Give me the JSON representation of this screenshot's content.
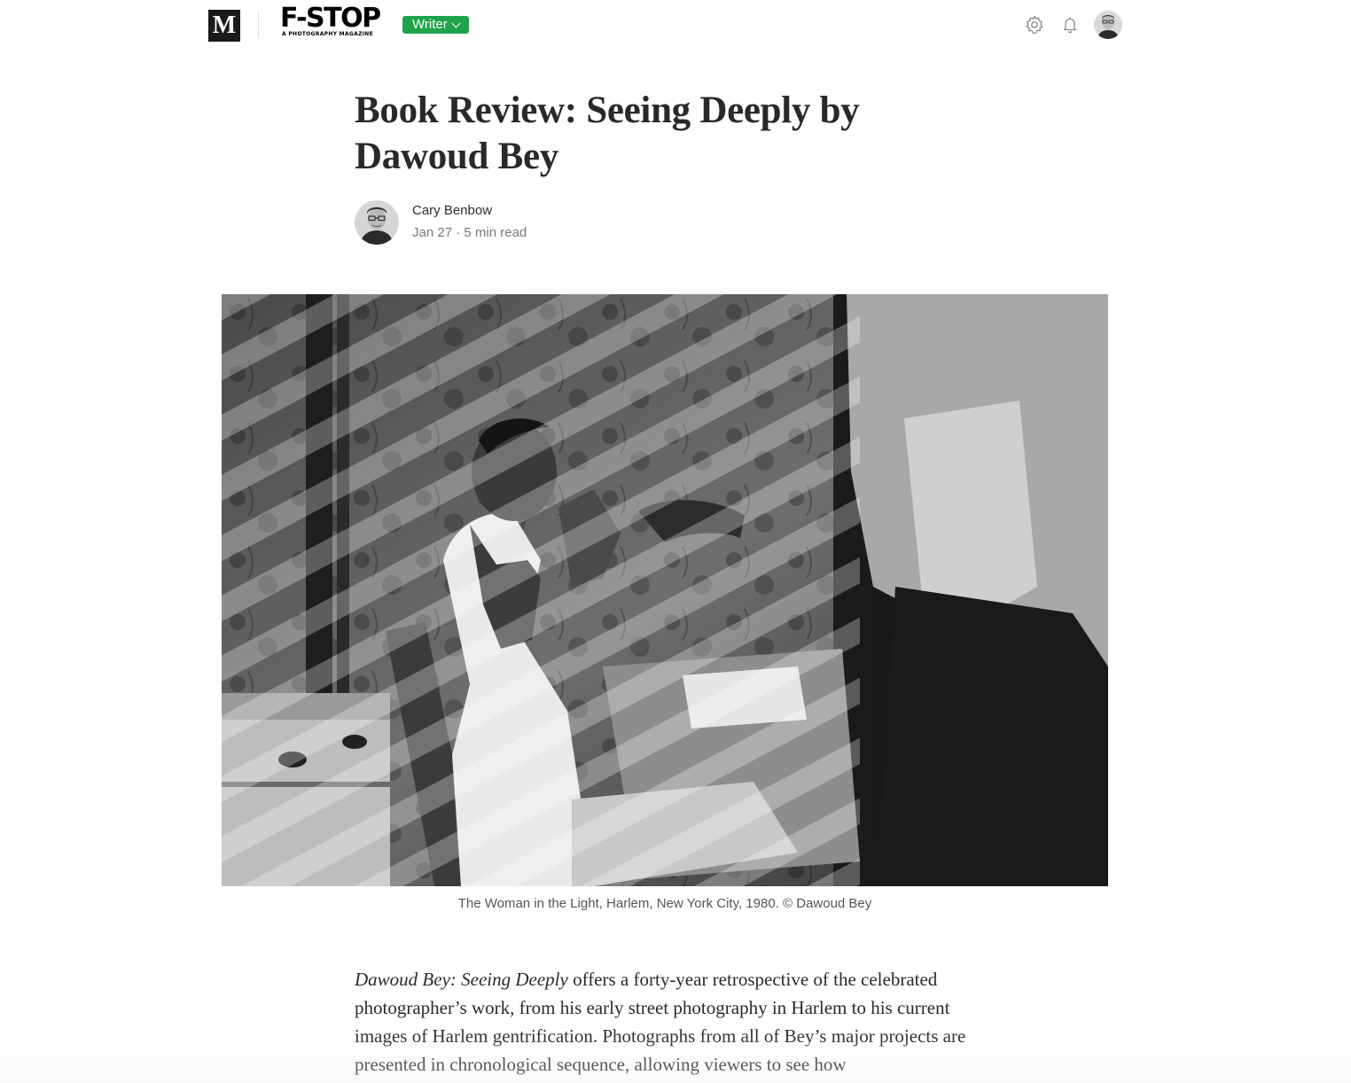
{
  "nav": {
    "medium_logo": "M",
    "publication_name": "F-STOP",
    "publication_tagline": "A PHOTOGRAPHY MAGAZINE",
    "writer_button": "Writer",
    "icons": [
      "settings-icon",
      "bell-icon",
      "avatar"
    ]
  },
  "article": {
    "title": "Book Review: Seeing Deeply by Dawoud Bey",
    "author": "Cary Benbow",
    "date": "Jan 27",
    "separator": "·",
    "read_time": "5 min read",
    "figure_caption": "The Woman in the Light, Harlem, New York City, 1980. © Dawoud Bey",
    "body_intro_italic": "Dawoud Bey: Seeing Deeply",
    "body_intro_rest": " offers a forty-year retrospective of the celebrated photographer’s work, from his early street photography in Harlem to his current images of Harlem gentrification. Photographs from all of Bey’s major projects are presented in chronological sequence, allowing viewers to see how"
  },
  "colors": {
    "accent_green": "#1fa34a",
    "text": "#1f1f1f",
    "muted": "#757575"
  }
}
